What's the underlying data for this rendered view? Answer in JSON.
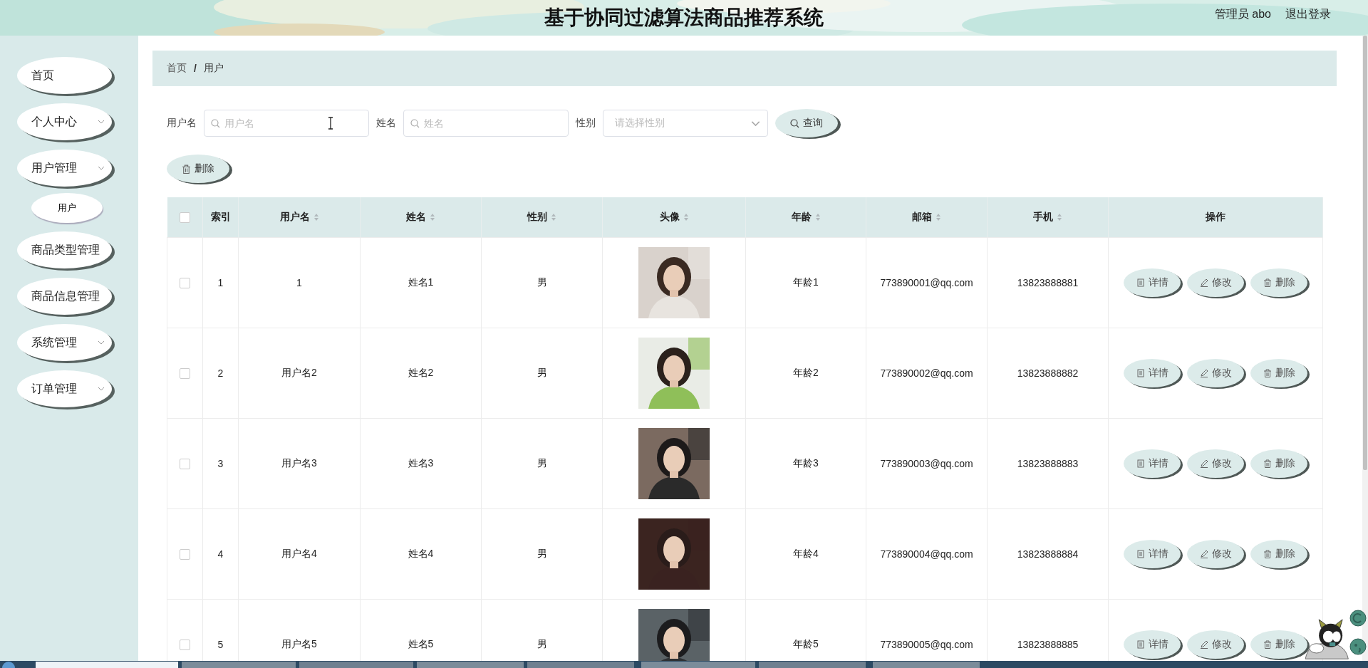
{
  "header": {
    "title": "基于协同过滤算法商品推荐系统",
    "user": "管理员 abo",
    "logout": "退出登录"
  },
  "sidebar": {
    "items": [
      {
        "label": "首页",
        "kind": "item"
      },
      {
        "label": "个人中心",
        "kind": "submenu"
      },
      {
        "label": "用户管理",
        "kind": "submenu",
        "children": [
          {
            "label": "用户"
          }
        ]
      },
      {
        "label": "商品类型管理",
        "kind": "item"
      },
      {
        "label": "商品信息管理",
        "kind": "item"
      },
      {
        "label": "系统管理",
        "kind": "submenu"
      },
      {
        "label": "订单管理",
        "kind": "submenu"
      }
    ]
  },
  "breadcrumb": {
    "items": [
      "首页",
      "用户"
    ],
    "separator": "/"
  },
  "search": {
    "fields": [
      {
        "label": "用户名",
        "placeholder": "用户名",
        "kind": "text"
      },
      {
        "label": "姓名",
        "placeholder": "姓名",
        "kind": "text"
      },
      {
        "label": "性别",
        "placeholder": "请选择性别",
        "kind": "select"
      }
    ],
    "button": "查询"
  },
  "delete_button": "删除",
  "table": {
    "columns": [
      {
        "kind": "checkbox",
        "checked": false
      },
      {
        "label": "索引",
        "sortable": false
      },
      {
        "label": "用户名",
        "sortable": true
      },
      {
        "label": "姓名",
        "sortable": true
      },
      {
        "label": "性别",
        "sortable": true
      },
      {
        "label": "头像",
        "sortable": true
      },
      {
        "label": "年龄",
        "sortable": true
      },
      {
        "label": "邮箱",
        "sortable": true
      },
      {
        "label": "手机",
        "sortable": true
      },
      {
        "label": "操作",
        "sortable": false
      }
    ],
    "rows": [
      {
        "cells": [
          {
            "kind": "checkbox",
            "checked": false
          },
          "1",
          "1",
          "姓名1",
          "男",
          {
            "kind": "picture"
          },
          "年龄1",
          "773890001@qq.com",
          "13823888881"
        ],
        "actions": [
          "详情",
          "修改",
          "删除"
        ]
      },
      {
        "cells": [
          {
            "kind": "checkbox",
            "checked": false
          },
          "2",
          "用户名2",
          "姓名2",
          "男",
          {
            "kind": "picture"
          },
          "年龄2",
          "773890002@qq.com",
          "13823888882"
        ],
        "actions": [
          "详情",
          "修改",
          "删除"
        ]
      },
      {
        "cells": [
          {
            "kind": "checkbox",
            "checked": false
          },
          "3",
          "用户名3",
          "姓名3",
          "男",
          {
            "kind": "picture"
          },
          "年龄3",
          "773890003@qq.com",
          "13823888883"
        ],
        "actions": [
          "详情",
          "修改",
          "删除"
        ]
      },
      {
        "cells": [
          {
            "kind": "checkbox",
            "checked": false
          },
          "4",
          "用户名4",
          "姓名4",
          "男",
          {
            "kind": "picture"
          },
          "年龄4",
          "773890004@qq.com",
          "13823888884"
        ],
        "actions": [
          "详情",
          "修改",
          "删除"
        ]
      },
      {
        "cells": [
          {
            "kind": "checkbox",
            "checked": false
          },
          "5",
          "用户名5",
          "姓名5",
          "男",
          {
            "kind": "picture"
          },
          "年龄5",
          "773890005@qq.com",
          "13823888885"
        ],
        "actions": [
          "详情",
          "修改",
          "删除"
        ]
      }
    ]
  }
}
